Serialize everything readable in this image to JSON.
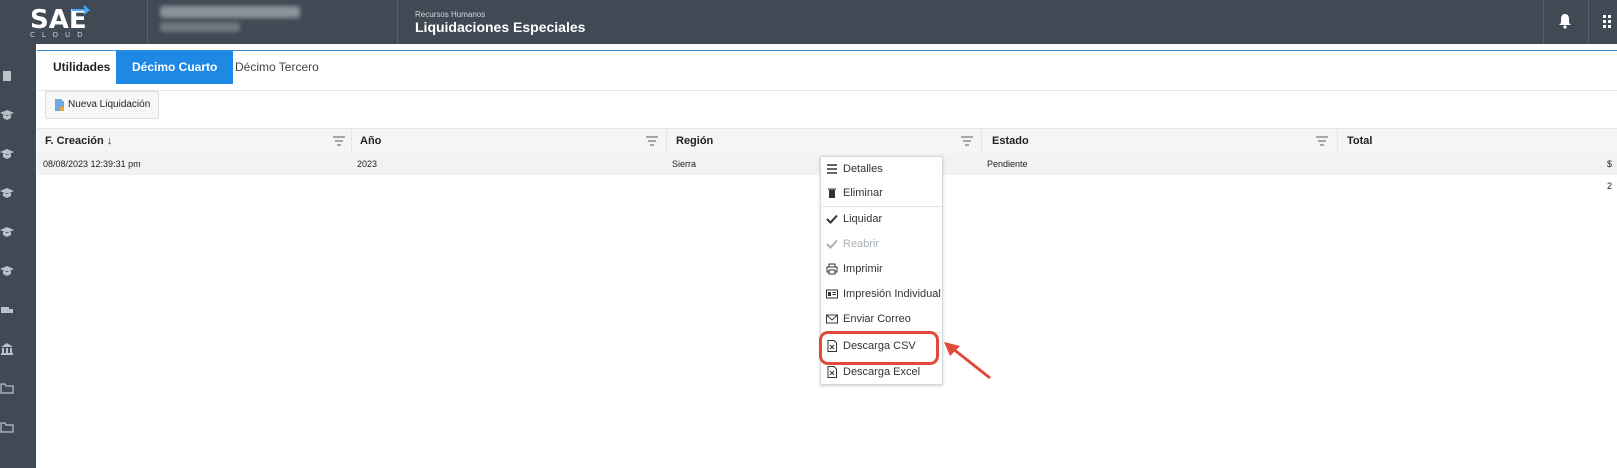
{
  "header": {
    "logo_text": "SAE",
    "logo_sub": "CLOUD",
    "module": "Recursos Humanos",
    "title": "Liquidaciones Especiales"
  },
  "tabs": [
    {
      "label": "Utilidades"
    },
    {
      "label": "Décimo Cuarto"
    },
    {
      "label": "Décimo Tercero"
    }
  ],
  "toolbar": {
    "new_label": "Nueva Liquidación"
  },
  "grid": {
    "columns": [
      "F. Creación ↓",
      "Año",
      "Región",
      "Estado",
      "Total"
    ],
    "row": {
      "fecha": "08/08/2023 12:39:31 pm",
      "anio": "2023",
      "region": "Sierra",
      "estado": "Pendiente",
      "total": "$ 2"
    }
  },
  "menu": [
    {
      "label": "Detalles",
      "icon": "list-icon"
    },
    {
      "label": "Eliminar",
      "icon": "trash-icon"
    },
    {
      "label": "Liquidar",
      "icon": "check-icon"
    },
    {
      "label": "Reabrir",
      "icon": "check-icon",
      "disabled": true
    },
    {
      "label": "Imprimir",
      "icon": "printer-icon"
    },
    {
      "label": "Impresión Individual",
      "icon": "id-card-icon"
    },
    {
      "label": "Enviar Correo",
      "icon": "envelope-icon"
    },
    {
      "label": "Descarga CSV",
      "icon": "file-excel-icon"
    },
    {
      "label": "Descarga Excel",
      "icon": "file-excel-icon"
    }
  ],
  "colors": {
    "header_bg": "#3f4a54",
    "active_tab": "#1e88e5",
    "highlight": "#e04a3a"
  }
}
